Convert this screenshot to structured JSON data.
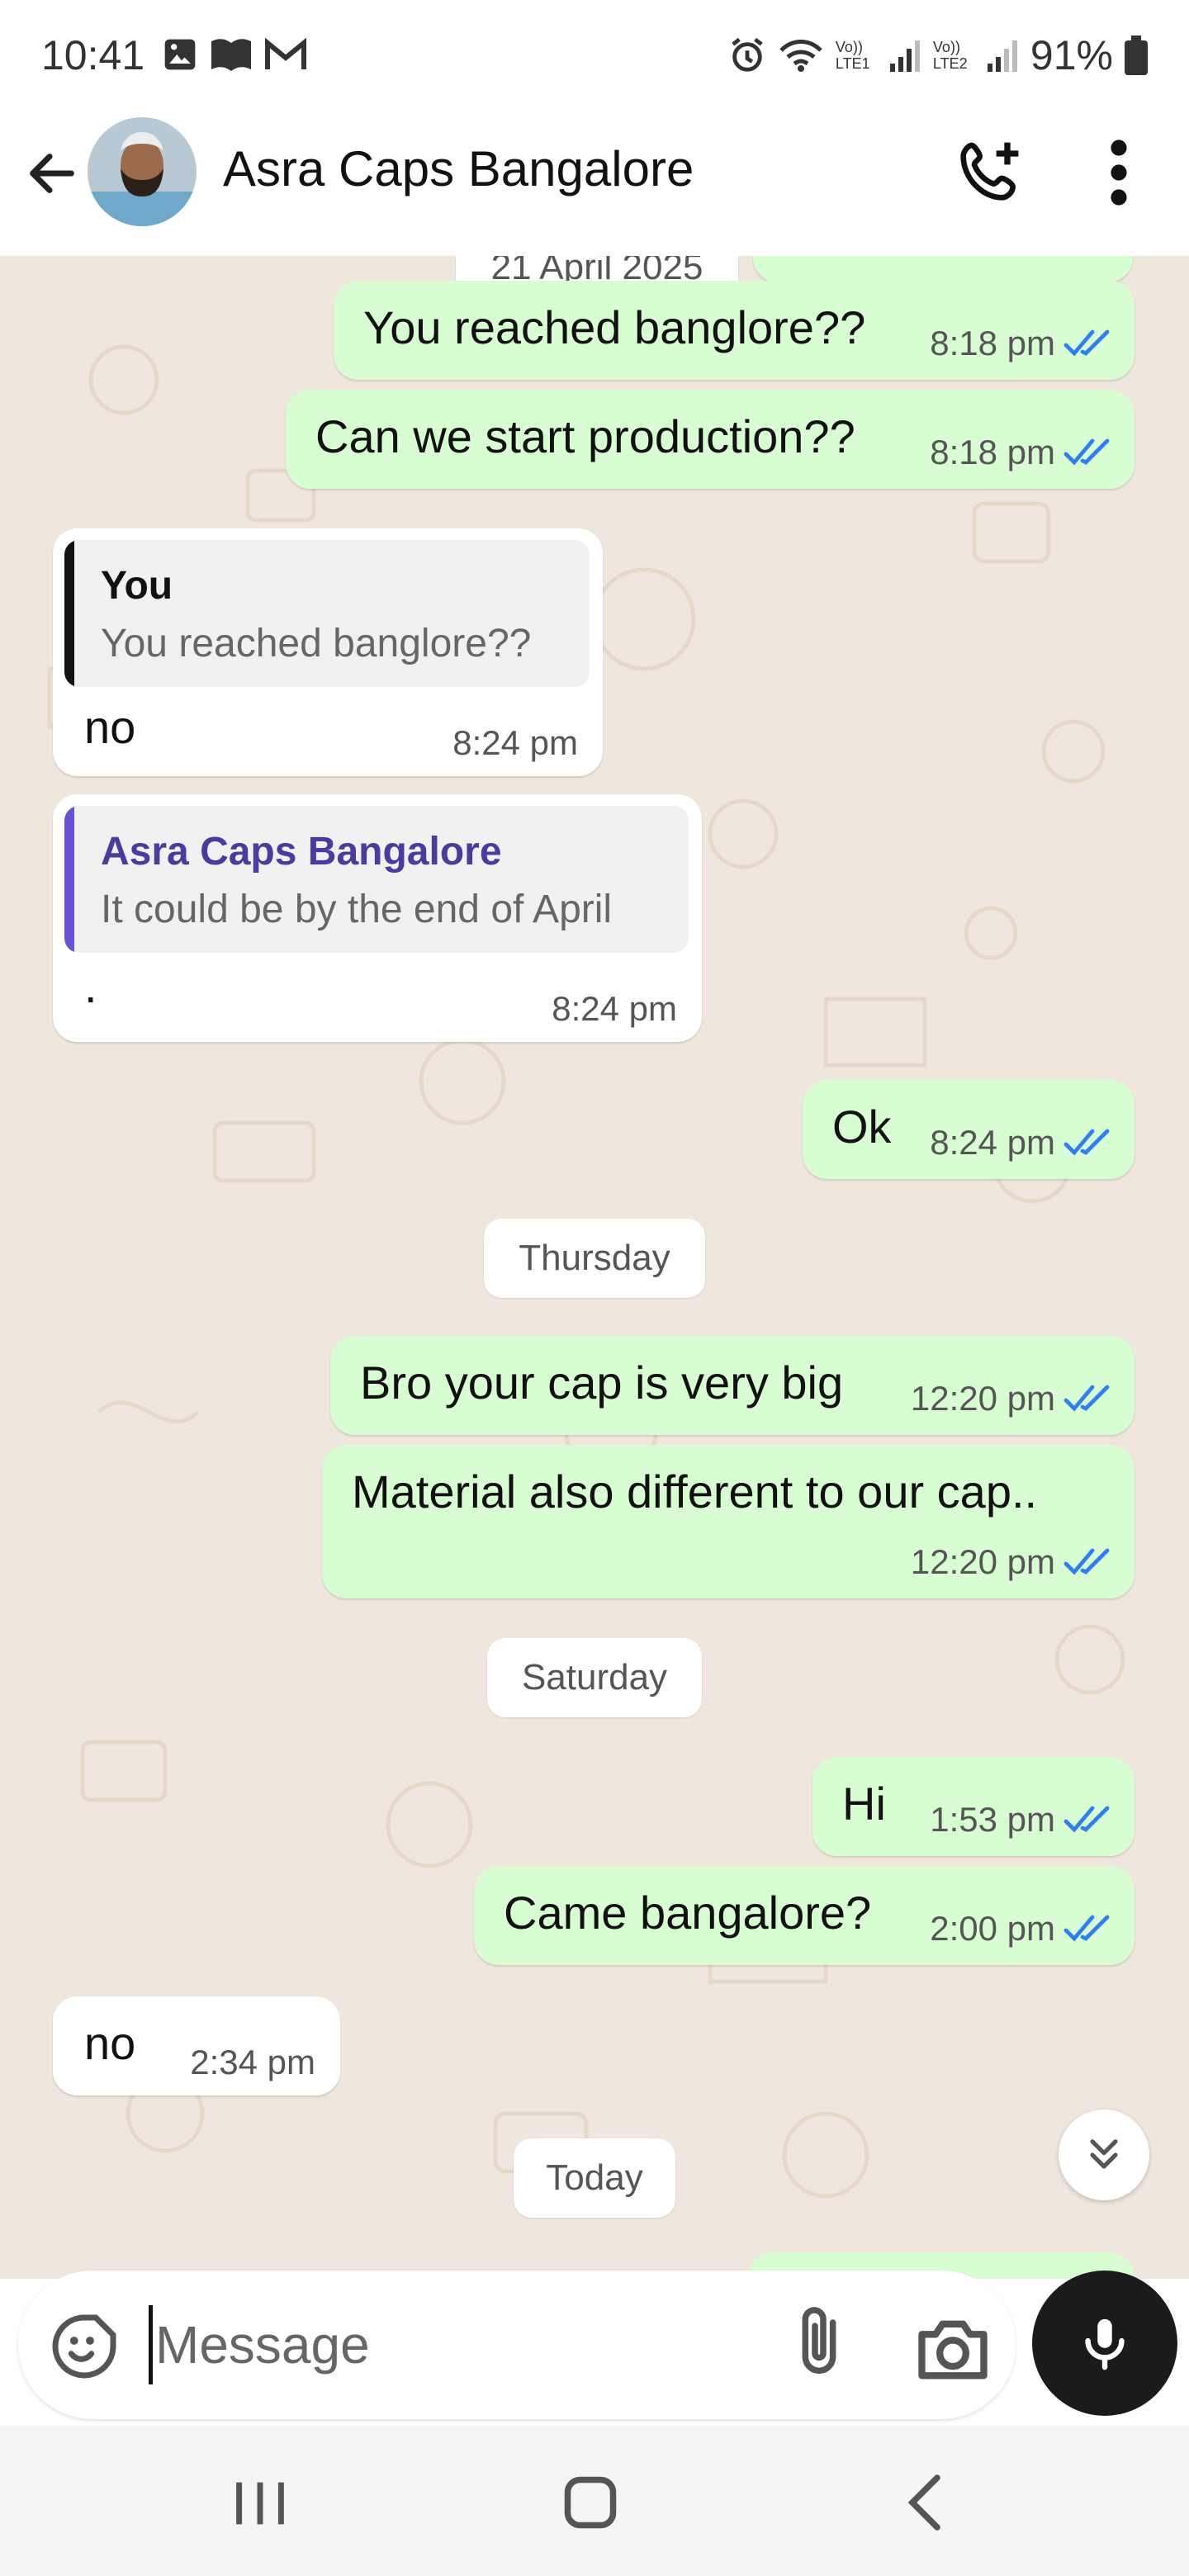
{
  "status_bar": {
    "time": "10:41",
    "battery": "91%",
    "network_1": "Vo)) LTE1",
    "network_2": "Vo)) LTE2",
    "icons": [
      "gallery-icon",
      "book-icon",
      "gmail-icon",
      "alarm-icon",
      "wifi-icon",
      "signal-icon",
      "battery-icon"
    ]
  },
  "header": {
    "title": "Asra Caps Bangalore",
    "icons": [
      "back-arrow-icon",
      "avatar",
      "add-call-icon",
      "more-vert-icon"
    ]
  },
  "chat": {
    "date_top": "21 April 2025",
    "messages": [
      {
        "direction": "out",
        "text": "You reached banglore??",
        "time": "8:18 pm"
      },
      {
        "direction": "out",
        "text": "Can we start production??",
        "time": "8:18 pm"
      },
      {
        "direction": "in",
        "reply_name": "You",
        "reply_text": "You reached banglore??",
        "text": "no",
        "time": "8:24 pm"
      },
      {
        "direction": "in",
        "reply_name": "Asra Caps Bangalore",
        "reply_text": "It could be by the end of April",
        "text": ".",
        "time": "8:24 pm"
      },
      {
        "direction": "out",
        "text": "Ok",
        "time": "8:24 pm"
      },
      {
        "direction": "out",
        "text": "Bro your cap is very big",
        "time": "12:20 pm"
      },
      {
        "direction": "out",
        "text": "Material also different to our cap..",
        "time": "12:20 pm"
      },
      {
        "direction": "out",
        "text": "Hi",
        "time": "1:53 pm"
      },
      {
        "direction": "out",
        "text": "Came bangalore?",
        "time": "2:00 pm"
      },
      {
        "direction": "in",
        "text": "no",
        "time": "2:34 pm"
      }
    ],
    "dividers": [
      "Thursday",
      "Saturday",
      "Today"
    ]
  },
  "composer": {
    "placeholder": "Message"
  },
  "colors": {
    "outgoing_bubble": "#d9fdd3",
    "incoming_bubble": "#ffffff",
    "chat_background": "#efe7dd",
    "read_ticks": "#2f80ed",
    "reply_you_bar": "#111111",
    "reply_contact_bar": "#6a4fd8",
    "reply_contact_name": "#4b3aa0"
  }
}
